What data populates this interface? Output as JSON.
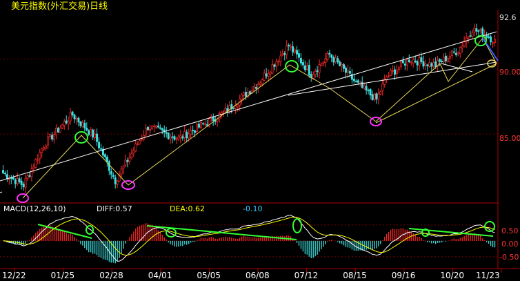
{
  "header": {
    "title": "美元指数(外汇交易)日线"
  },
  "colors": {
    "background": "#000000",
    "up": "#ff2a2a",
    "down": "#40e0e0",
    "axis": "#b40000",
    "grid": "#7a0000",
    "title": "#ffff00",
    "diff_line": "#ffffff",
    "dea_line": "#ffff00",
    "annotation_green": "#33ff33",
    "annotation_magenta": "#ff33ff"
  },
  "price_axis": {
    "ticks": [
      "92.6",
      "90.00",
      "85.00"
    ]
  },
  "macd": {
    "label": "MACD(12,26,10)",
    "diff_label": "DIFF:0.57",
    "dea_label": "DEA:0.62",
    "macd_value": "-0.10",
    "ticks": [
      "0.50",
      "0.00",
      "-0.50"
    ]
  },
  "chart_data": [
    {
      "type": "candlestick",
      "title": "美元指数(外汇交易)日线",
      "x_labels": [
        "12/22",
        "01/25",
        "02/28",
        "04/01",
        "05/05",
        "06/08",
        "07/12",
        "08/15",
        "09/16",
        "10/20",
        "11/23"
      ],
      "y_ticks": [
        92.6,
        90.0,
        85.0
      ],
      "ylim": [
        80.5,
        93.3
      ],
      "grid": true,
      "anchors": [
        [
          0,
          82.4
        ],
        [
          10,
          81.6
        ],
        [
          20,
          84.3
        ],
        [
          34,
          86.3
        ],
        [
          45,
          84.8
        ],
        [
          55,
          81.9
        ],
        [
          71,
          85.5
        ],
        [
          86,
          84.7
        ],
        [
          109,
          86.5
        ],
        [
          125,
          88.4
        ],
        [
          140,
          90.9
        ],
        [
          151,
          89.0
        ],
        [
          160,
          90.3
        ],
        [
          173,
          88.4
        ],
        [
          183,
          87.3
        ],
        [
          188,
          88.8
        ],
        [
          199,
          90.0
        ],
        [
          212,
          89.6
        ],
        [
          223,
          90.6
        ],
        [
          230,
          92.0
        ],
        [
          237,
          91.6
        ],
        [
          241,
          91.2
        ]
      ]
    },
    {
      "type": "histogram",
      "title": "MACD(12,26,10)",
      "ylim": [
        -0.85,
        0.8
      ],
      "y_ticks": [
        0.5,
        0.0,
        -0.5
      ],
      "diff": 0.57,
      "dea": 0.62,
      "macd": -0.1
    }
  ]
}
